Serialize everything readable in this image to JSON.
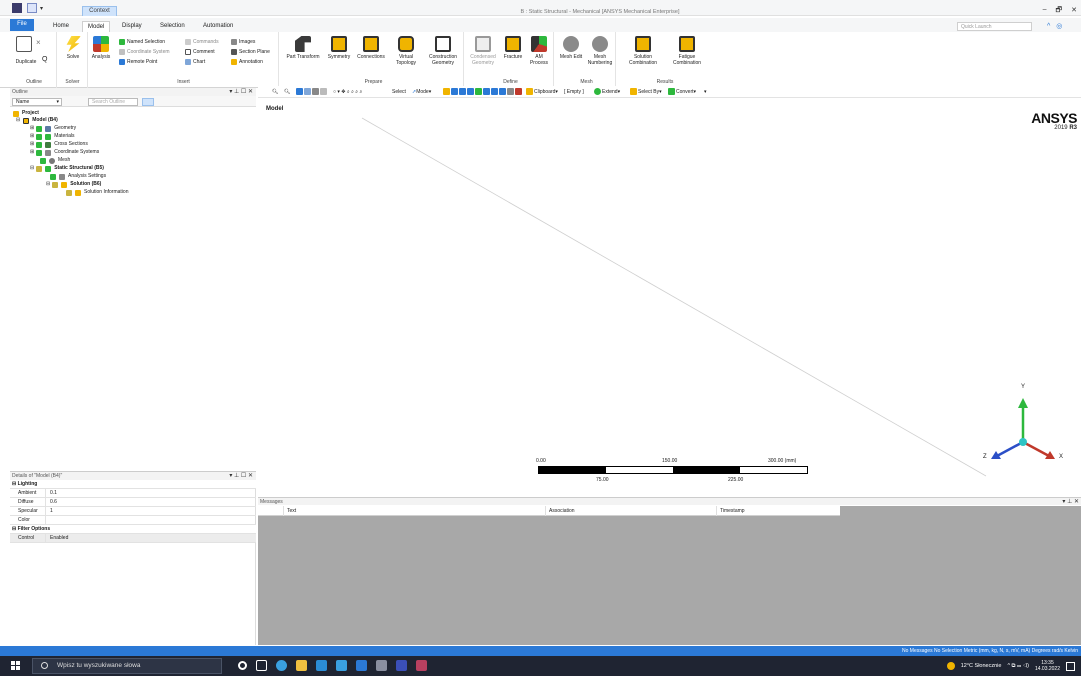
{
  "window": {
    "title": "B : Static Structural - Mechanical [ANSYS Mechanical Enterprise]",
    "context_tab": "Context",
    "controls": [
      "–",
      "🗗",
      "✕"
    ]
  },
  "ribbon_tabs": [
    "File",
    "Home",
    "Model",
    "Display",
    "Selection",
    "Automation"
  ],
  "active_tab": "Model",
  "quick_launch": {
    "placeholder": "Quick Launch"
  },
  "ribbon": {
    "outline": {
      "label": "Outline",
      "duplicate": "Duplicate",
      "find_icon": "search-icon"
    },
    "solve": {
      "label": "Solver",
      "solve": "Solve"
    },
    "insert": {
      "label": "Insert",
      "analysis": "Analysis",
      "named_selection": "Named Selection",
      "coordinate_system": "Coordinate System",
      "remote_point": "Remote Point",
      "commands": "Commands",
      "comment": "Comment",
      "chart": "Chart",
      "images": "Images",
      "section_plane": "Section Plane",
      "annotation": "Annotation"
    },
    "prepare": {
      "label": "Prepare",
      "part_transform": "Part Transform",
      "symmetry": "Symmetry",
      "connections": "Connections",
      "virtual_topology": "Virtual Topology",
      "construction_geometry": "Construction Geometry"
    },
    "define": {
      "label": "Define",
      "condensed_geometry": "Condensed Geometry",
      "fracture": "Fracture",
      "am_process": "AM Process"
    },
    "mesh": {
      "label": "Mesh",
      "mesh_edit": "Mesh Edit",
      "mesh_numbering": "Mesh Numbering"
    },
    "results": {
      "label": "Results",
      "solution_combination": "Solution Combination",
      "fatigue_combination": "Fatigue Combination"
    }
  },
  "outline": {
    "title": "Outline",
    "filter_name": "Name",
    "search_placeholder": "Search Outline",
    "tree": [
      {
        "label": "Project",
        "bold": true
      },
      {
        "label": "Model (B4)",
        "bold": true
      },
      {
        "label": "Geometry",
        "bold": false
      },
      {
        "label": "Materials",
        "bold": false
      },
      {
        "label": "Cross Sections",
        "bold": false
      },
      {
        "label": "Coordinate Systems",
        "bold": false
      },
      {
        "label": "Mesh",
        "bold": false
      },
      {
        "label": "Static Structural (B5)",
        "bold": true
      },
      {
        "label": "Analysis Settings",
        "bold": false
      },
      {
        "label": "Solution (B6)",
        "bold": true
      },
      {
        "label": "Solution Information",
        "bold": false
      }
    ]
  },
  "details": {
    "title": "Details of \"Model (B4)\"",
    "lighting": "Lighting",
    "rows": [
      {
        "key": "Ambient",
        "value": "0.1"
      },
      {
        "key": "Diffuse",
        "value": "0.6"
      },
      {
        "key": "Specular",
        "value": "1"
      },
      {
        "key": "Color",
        "value": ""
      }
    ],
    "filter_options": "Filter Options",
    "control": {
      "key": "Control",
      "value": "Enabled"
    }
  },
  "graphics_toolbar": {
    "select": "Select",
    "mode": "Mode",
    "clipboard": "Clipboard",
    "empty": "[ Empty ]",
    "extend": "Extend",
    "select_by": "Select By",
    "convert": "Convert"
  },
  "viewport": {
    "label": "Model",
    "logo": "ANSYS",
    "version_prefix": "2019",
    "version_suffix": "R3",
    "scale": {
      "v0": "0.00",
      "v1": "75.00",
      "v2": "150.00",
      "v3": "225.00",
      "v4": "300.00 (mm)"
    },
    "axes": {
      "x": "X",
      "y": "Y",
      "z": "Z"
    }
  },
  "messages": {
    "title": "Messages",
    "columns": [
      "Text",
      "Association",
      "Timestamp"
    ]
  },
  "statusbar": {
    "text": "No Messages   No Selection   Metric (mm, kg, N, s, mV, mA)   Degrees   rad/s   Kelvin"
  },
  "taskbar": {
    "search_placeholder": "Wpisz tu wyszukiwane słowa",
    "weather": "12°C  Słonecznie",
    "time": "13:35",
    "date": "14.03.2022"
  },
  "colors": {
    "accent": "#2b79d6",
    "taskbar": "#1f2432",
    "messages_bg": "#a8a8a8",
    "axis_x": "#c0392b",
    "axis_y": "#2db83d",
    "axis_z": "#2b4fc7",
    "axis_center": "#2fc4c4"
  }
}
